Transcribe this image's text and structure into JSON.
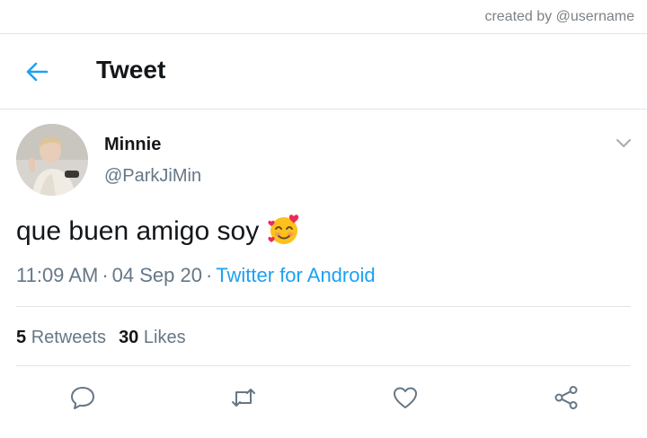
{
  "watermark": "created by @username",
  "header": {
    "title": "Tweet"
  },
  "tweet": {
    "author_name": "Minnie",
    "author_handle": "@ParkJiMin",
    "text": "que buen amigo soy",
    "emoji": "smiling-face-with-hearts-icon",
    "time": "11:09 AM",
    "date": "04 Sep 20",
    "separator": "·",
    "source": "Twitter for Android"
  },
  "stats": {
    "retweets_count": "5",
    "retweets_label": "Retweets",
    "likes_count": "30",
    "likes_label": "Likes"
  },
  "actions": [
    "reply-icon",
    "retweet-icon",
    "like-icon",
    "share-icon"
  ],
  "colors": {
    "accent": "#1da1f2",
    "text": "#14171a",
    "secondary_text": "#657786",
    "divider": "#e1e4e6"
  }
}
